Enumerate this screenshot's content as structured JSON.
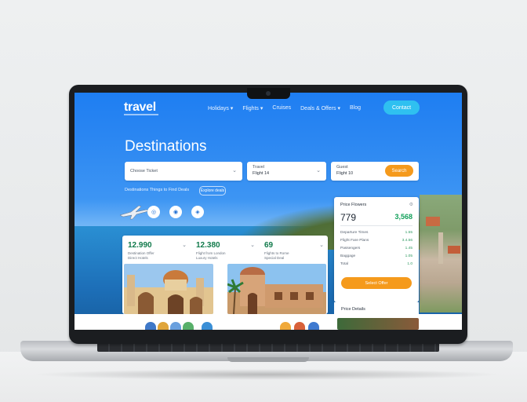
{
  "nav": {
    "logo": "travel",
    "items": [
      "Holidays ▾",
      "Flights ▾",
      "Cruises",
      "Deals & Offers ▾",
      "Blog"
    ],
    "cta": "Contact"
  },
  "hero": {
    "title": "Destinations"
  },
  "search": {
    "destination_placeholder": "Choose Ticket",
    "dates_label": "Travel",
    "dates_value": "Flight 14",
    "guests_label": "Guest",
    "guests_value": "Flight 10",
    "button": "Search",
    "filters_text": "Destinations  Things to  Find Deals",
    "filter_pill": "Explore deals"
  },
  "mini_icons": [
    "◎",
    "◉",
    "◈"
  ],
  "deals": [
    {
      "price": "12.990",
      "line1": "Destination Offer",
      "line2": "Direct Hotels"
    },
    {
      "price": "12.380",
      "line1": "Flight from London",
      "line2": "Luxury Hotels"
    },
    {
      "price": "69",
      "line1": "Flights to Rome",
      "line2": "Special Deal"
    }
  ],
  "panel": {
    "heading": "Price Flowers",
    "big_left": "779",
    "big_right": "3,568",
    "rows": [
      {
        "label": "Departure Times",
        "value": "1.55"
      },
      {
        "label": "Flight Fare Plans",
        "value": "3.4.56"
      },
      {
        "label": "Passengers",
        "value": "1.45"
      },
      {
        "label": "Baggage",
        "value": "1.05"
      },
      {
        "label": "Total",
        "value": "1.0"
      }
    ],
    "button": "Select Offer",
    "second_heading": "Price Details"
  },
  "colors": {
    "accent": "#f59a1c",
    "brand": "#1e7ef2",
    "price_green": "#117a4b"
  }
}
